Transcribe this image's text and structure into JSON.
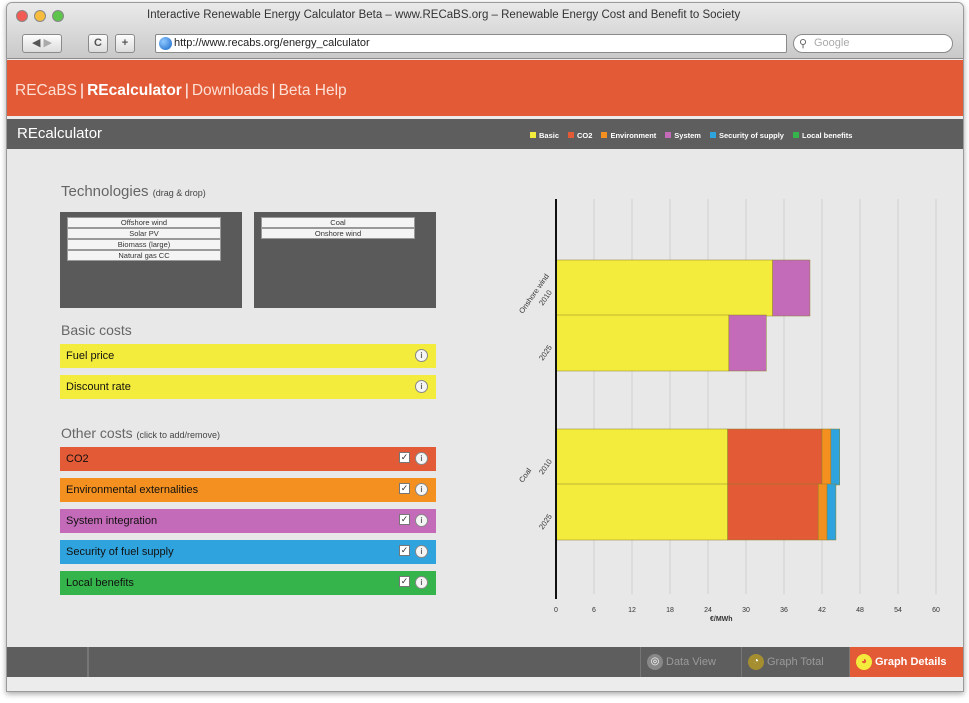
{
  "window": {
    "title": "Interactive Renewable Energy Calculator Beta – www.RECaBS.org – Renewable Energy Cost and Benefit to Society"
  },
  "browser": {
    "back": "◀",
    "forward": "▶",
    "reload": "C",
    "add": "+",
    "url": "http://www.recabs.org/energy_calculator",
    "search_placeholder": "Google"
  },
  "nav": {
    "links": [
      "RECaBS",
      "REcalculator",
      "Downloads",
      "Beta Help"
    ],
    "active": "REcalculator"
  },
  "subbar": {
    "title": "REcalculator",
    "legend": [
      {
        "label": "Basic",
        "color": "#f4ec3c"
      },
      {
        "label": "CO2",
        "color": "#e35a36"
      },
      {
        "label": "Environment",
        "color": "#f3901f"
      },
      {
        "label": "System",
        "color": "#c36ab8"
      },
      {
        "label": "Security of supply",
        "color": "#2fa3dd"
      },
      {
        "label": "Local benefits",
        "color": "#34b44a"
      }
    ]
  },
  "technologies": {
    "heading": "Technologies",
    "note": "(drag & drop)",
    "available": [
      "Offshore wind",
      "Solar PV",
      "Biomass (large)",
      "Natural gas CC"
    ],
    "selected": [
      "Coal",
      "Onshore wind"
    ]
  },
  "basic": {
    "heading": "Basic costs",
    "items": [
      "Fuel price",
      "Discount rate"
    ]
  },
  "other": {
    "heading": "Other costs",
    "note": "(click to add/remove)",
    "items": [
      {
        "label": "CO2",
        "color": "#e35a36"
      },
      {
        "label": "Environmental externalities",
        "color": "#f3901f"
      },
      {
        "label": "System integration",
        "color": "#c36ab8"
      },
      {
        "label": "Security of fuel supply",
        "color": "#2fa3dd"
      },
      {
        "label": "Local benefits",
        "color": "#34b44a"
      }
    ]
  },
  "chart_data": {
    "type": "bar",
    "orientation": "horizontal",
    "stacked": true,
    "xlabel": "€/MWh",
    "xlim": [
      0,
      60
    ],
    "xticks": [
      0,
      6,
      12,
      18,
      24,
      30,
      36,
      42,
      48,
      54,
      60
    ],
    "groups": [
      {
        "name": "Onshore wind",
        "bars": [
          {
            "label": "2010",
            "segments": {
              "Basic": 34.2,
              "CO2": 0,
              "Environment": 0,
              "System": 5.9,
              "Security of supply": 0
            }
          },
          {
            "label": "2025",
            "segments": {
              "Basic": 27.3,
              "CO2": 0,
              "Environment": 0,
              "System": 5.9,
              "Security of supply": 0
            }
          }
        ]
      },
      {
        "name": "Coal",
        "bars": [
          {
            "label": "2010",
            "segments": {
              "Basic": 27.1,
              "CO2": 14.9,
              "Environment": 1.4,
              "System": 0,
              "Security of supply": 1.4
            }
          },
          {
            "label": "2025",
            "segments": {
              "Basic": 27.1,
              "CO2": 14.3,
              "Environment": 1.4,
              "System": 0,
              "Security of supply": 1.4
            }
          }
        ]
      }
    ],
    "colors": {
      "Basic": "#f4ec3c",
      "CO2": "#e35a36",
      "Environment": "#f3901f",
      "System": "#c36ab8",
      "Security of supply": "#2fa3dd"
    }
  },
  "bottom": {
    "buttons": [
      "Data View",
      "Graph Total",
      "Graph Details"
    ],
    "active": "Graph Details"
  }
}
